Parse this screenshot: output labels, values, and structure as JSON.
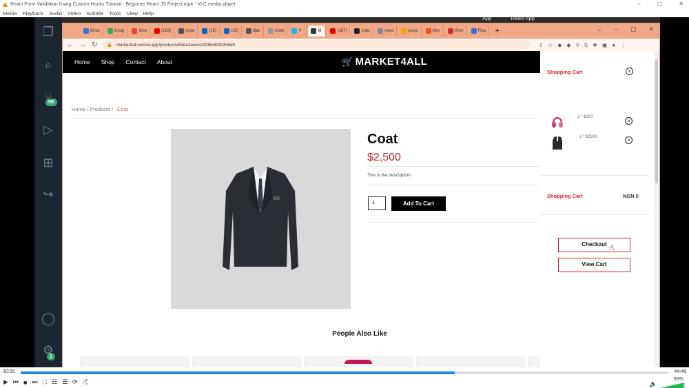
{
  "vlc": {
    "title": "React Form Validation Using Custom Hooks Tutorial - Beginner React JS Project.mp4 - VLC media player",
    "menu": [
      "Media",
      "Playback",
      "Audio",
      "Video",
      "Subtitle",
      "Tools",
      "View",
      "Help"
    ],
    "time_elapsed": "30:00",
    "time_total": "44:46",
    "progress": 0.67,
    "volume": "95%"
  },
  "vscode": {
    "badge_source": "5K",
    "badge_settings": "1"
  },
  "desktop_tabs": [
    "App",
    "React App"
  ],
  "chrome": {
    "tabs": [
      "Brow",
      "Goog",
      "Inbo",
      "(183)",
      "proje",
      "(15)",
      "(15)",
      "djan",
      "mark",
      "V",
      "M",
      "(187)",
      "Jobs",
      "react",
      "javas",
      "Micr",
      "@en",
      "Flou"
    ],
    "url": "market4all.vercel.app/products/63ec2eeec41f08c80f1906e9"
  },
  "nav": {
    "links": [
      "Home",
      "Shop",
      "Contact",
      "About"
    ],
    "logo": "MARKET4ALL"
  },
  "breadcrumb": {
    "home": "Home /",
    "products": "Products /",
    "current": "Coat"
  },
  "product": {
    "name": "Coat",
    "price": "$2,500",
    "description": "This is the description",
    "quantity": "1",
    "add_to_cart": "Add To Cart"
  },
  "related": {
    "heading": "People Also Like"
  },
  "cart": {
    "title": "Shopping Cart",
    "items": [
      {
        "icon": "headphones-icon",
        "qty_price": "3 * $100"
      },
      {
        "icon": "suit-icon",
        "qty_price": "2 * $2500"
      }
    ],
    "total_label": "Shopping Cart",
    "total_value": "NGN 0",
    "checkout": "Checkout",
    "view_cart": "View Cart"
  },
  "colors": {
    "accent_red": "#d8232a",
    "tabbar": "#f0a887"
  }
}
